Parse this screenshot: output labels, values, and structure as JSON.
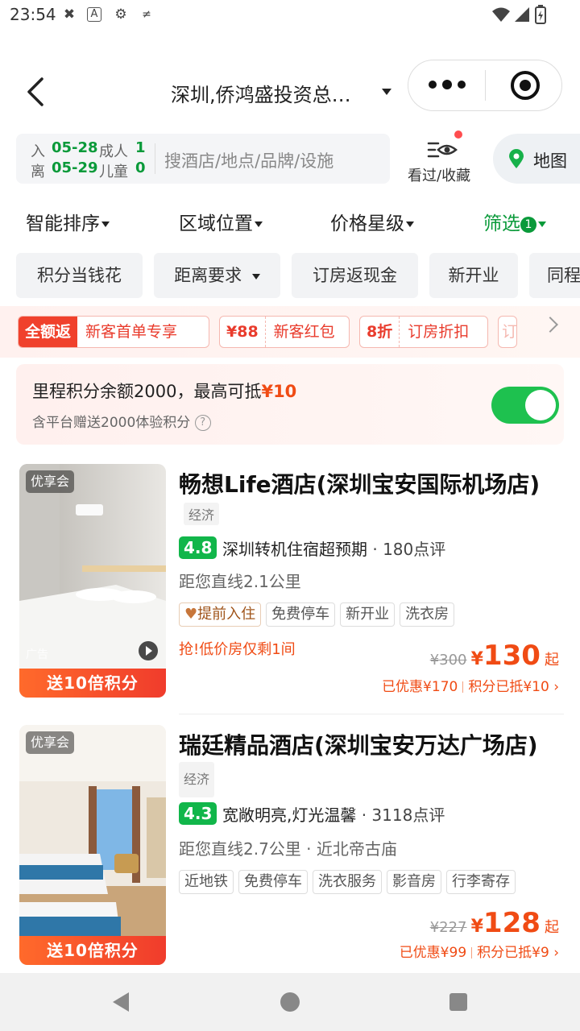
{
  "status_bar": {
    "time": "23:54"
  },
  "header": {
    "title": "深圳,侨鸿盛投资总…"
  },
  "search": {
    "checkin_label": "入",
    "checkin_date": "05-28",
    "checkout_label": "离",
    "checkout_date": "05-29",
    "adults_label": "成人",
    "adults": "1",
    "children_label": "儿童",
    "children": "0",
    "placeholder": "搜酒店/地点/品牌/设施",
    "history_label": "看过/收藏",
    "map_label": "地图"
  },
  "sort_tabs": [
    {
      "label": "智能排序"
    },
    {
      "label": "区域位置"
    },
    {
      "label": "价格星级"
    },
    {
      "label": "筛选",
      "badge": "1"
    }
  ],
  "chips": [
    "积分当钱花",
    "距离要求",
    "订房返现金",
    "新开业",
    "同程"
  ],
  "coupons": [
    {
      "lead": "全额返",
      "text": "新客首单专享"
    },
    {
      "lead": "¥88",
      "text": "新客红包"
    },
    {
      "lead": "8折",
      "text": "订房折扣"
    },
    {
      "lead": "订",
      "text": ""
    }
  ],
  "points_banner": {
    "main": "里程积分余额2000，最高可抵",
    "amount": "¥10",
    "sub": "含平台赠送2000体验积分",
    "toggle_on": true
  },
  "hotels": [
    {
      "badge": "优享会",
      "ad": "广告",
      "band": "送10倍积分",
      "name": "畅想Life酒店(深圳宝安国际机场店)",
      "level": "经济",
      "score": "4.8",
      "slogan": "深圳转机住宿超预期",
      "reviews": " · 180点评",
      "distance": "距您直线2.1公里",
      "tags": [
        "提前入住",
        "免费停车",
        "新开业",
        "洗衣房"
      ],
      "urgent": "抢!低价房仅剩1间",
      "price_old": "¥300",
      "price_symbol": "¥",
      "price": "130",
      "price_suffix": "起",
      "discount": "已优惠¥170",
      "points_used": "积分已抵¥10"
    },
    {
      "badge": "优享会",
      "band": "送10倍积分",
      "name": "瑞廷精品酒店(深圳宝安万达广场店)",
      "level": "经济",
      "score": "4.3",
      "slogan": "宽敞明亮,灯光温馨",
      "reviews": " · 3118点评",
      "distance": "距您直线2.7公里 · 近北帝古庙",
      "tags": [
        "近地铁",
        "免费停车",
        "洗衣服务",
        "影音房",
        "行李寄存"
      ],
      "price_old": "¥227",
      "price_symbol": "¥",
      "price": "128",
      "price_suffix": "起",
      "discount": "已优惠¥99",
      "points_used": "积分已抵¥9"
    }
  ],
  "colors": {
    "brand_green": "#0a9a3a",
    "accent_orange": "#f04b14",
    "toggle_green": "#1ec14f"
  }
}
